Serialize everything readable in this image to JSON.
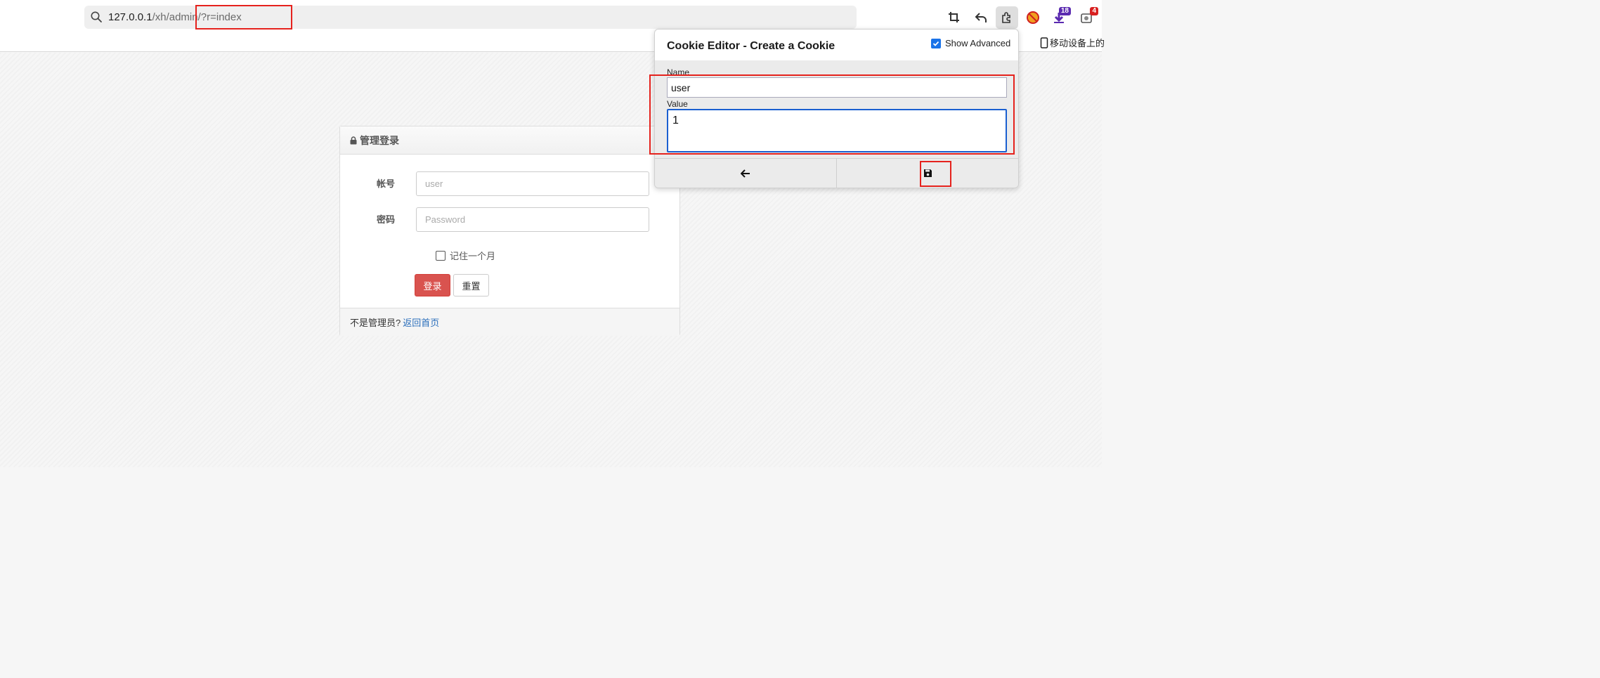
{
  "browser": {
    "url_host": "127.0.0.1",
    "url_path": "/xh/admin/?r=index",
    "toolbar_icons": [
      "crop-icon",
      "undo-icon",
      "extensions-icon",
      "blocker-icon",
      "download-icon",
      "badge-extension-icon"
    ],
    "download_badge": "18",
    "ext_badge": "4",
    "mobile_link": "移动设备上的"
  },
  "login": {
    "title": "管理登录",
    "username_label": "帐号",
    "username_placeholder": "user",
    "password_label": "密码",
    "password_placeholder": "Password",
    "remember_label": "记住一个月",
    "login_button": "登录",
    "reset_button": "重置",
    "footer_text": "不是管理员?",
    "footer_link": "返回首页"
  },
  "cookie_editor": {
    "title": "Cookie Editor - Create a Cookie",
    "show_advanced_label": "Show Advanced",
    "show_advanced_checked": true,
    "name_label": "Name",
    "name_value": "user",
    "value_label": "Value",
    "value_value": "1",
    "buttons": [
      "back-arrow-icon",
      "save-icon"
    ]
  },
  "colors": {
    "annotation_red": "#e5221d",
    "login_red": "#d9534f",
    "link_blue": "#2a6ebb",
    "focus_blue": "#1a5fd0"
  }
}
